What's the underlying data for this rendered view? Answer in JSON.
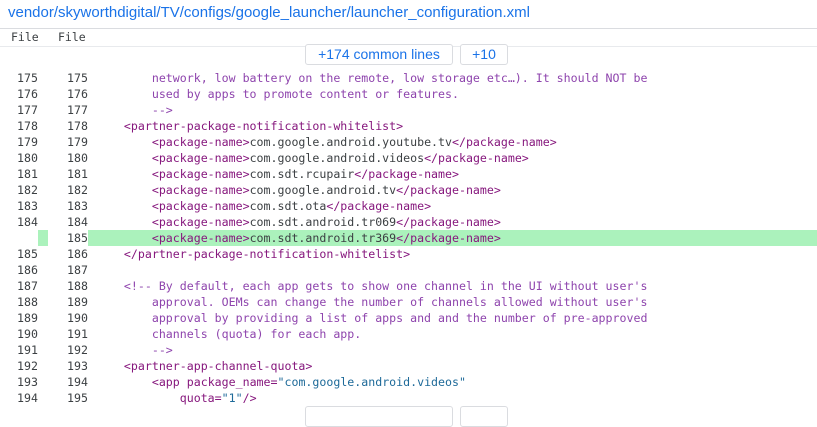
{
  "file_path": "vendor/skyworthdigital/TV/configs/google_launcher/launcher_configuration.xml",
  "columns": [
    "File",
    "File"
  ],
  "expand": {
    "common_lines": "+174 common lines",
    "more": "+10"
  },
  "lines": [
    {
      "l": "175",
      "r": "175",
      "type": "ctx",
      "segments": [
        {
          "t": "        network, low battery on the remote, low storage etc…). It should NOT be",
          "c": "c-com"
        }
      ]
    },
    {
      "l": "176",
      "r": "176",
      "type": "ctx",
      "segments": [
        {
          "t": "        used by apps to promote content or features.",
          "c": "c-com"
        }
      ]
    },
    {
      "l": "177",
      "r": "177",
      "type": "ctx",
      "segments": [
        {
          "t": "        -->",
          "c": "c-com"
        }
      ]
    },
    {
      "l": "178",
      "r": "178",
      "type": "ctx",
      "segments": [
        {
          "t": "    <partner-package-notification-whitelist>",
          "c": "c-tag"
        }
      ]
    },
    {
      "l": "179",
      "r": "179",
      "type": "ctx",
      "segments": [
        {
          "t": "        <package-name>",
          "c": "c-tag"
        },
        {
          "t": "com.google.android.youtube.tv",
          "c": ""
        },
        {
          "t": "</package-name>",
          "c": "c-tag"
        }
      ]
    },
    {
      "l": "180",
      "r": "180",
      "type": "ctx",
      "segments": [
        {
          "t": "        <package-name>",
          "c": "c-tag"
        },
        {
          "t": "com.google.android.videos",
          "c": ""
        },
        {
          "t": "</package-name>",
          "c": "c-tag"
        }
      ]
    },
    {
      "l": "181",
      "r": "181",
      "type": "ctx",
      "segments": [
        {
          "t": "        <package-name>",
          "c": "c-tag"
        },
        {
          "t": "com.sdt.rcupair",
          "c": ""
        },
        {
          "t": "</package-name>",
          "c": "c-tag"
        }
      ]
    },
    {
      "l": "182",
      "r": "182",
      "type": "ctx",
      "segments": [
        {
          "t": "        <package-name>",
          "c": "c-tag"
        },
        {
          "t": "com.google.android.tv",
          "c": ""
        },
        {
          "t": "</package-name>",
          "c": "c-tag"
        }
      ]
    },
    {
      "l": "183",
      "r": "183",
      "type": "ctx",
      "segments": [
        {
          "t": "        <package-name>",
          "c": "c-tag"
        },
        {
          "t": "com.sdt.ota",
          "c": ""
        },
        {
          "t": "</package-name>",
          "c": "c-tag"
        }
      ]
    },
    {
      "l": "184",
      "r": "184",
      "type": "ctx",
      "segments": [
        {
          "t": "        <package-name>",
          "c": "c-tag"
        },
        {
          "t": "com.sdt.android.tr069",
          "c": ""
        },
        {
          "t": "</package-name>",
          "c": "c-tag"
        }
      ]
    },
    {
      "l": "",
      "r": "185",
      "type": "added",
      "segments": [
        {
          "t": "        <package-name>",
          "c": "c-tag"
        },
        {
          "t": "com.sdt.android.tr369",
          "c": ""
        },
        {
          "t": "</package-name>",
          "c": "c-tag"
        }
      ]
    },
    {
      "l": "185",
      "r": "186",
      "type": "ctx",
      "segments": [
        {
          "t": "    </partner-package-notification-whitelist>",
          "c": "c-tag"
        }
      ]
    },
    {
      "l": "186",
      "r": "187",
      "type": "ctx",
      "segments": [
        {
          "t": "",
          "c": ""
        }
      ]
    },
    {
      "l": "187",
      "r": "188",
      "type": "ctx",
      "segments": [
        {
          "t": "    <!-- By default, each app gets to show one channel in the UI without user's",
          "c": "c-com"
        }
      ]
    },
    {
      "l": "188",
      "r": "189",
      "type": "ctx",
      "segments": [
        {
          "t": "        approval. OEMs can change the number of channels allowed without user's",
          "c": "c-com"
        }
      ]
    },
    {
      "l": "189",
      "r": "190",
      "type": "ctx",
      "segments": [
        {
          "t": "        approval by providing a list of apps and and the number of pre-approved",
          "c": "c-com"
        }
      ]
    },
    {
      "l": "190",
      "r": "191",
      "type": "ctx",
      "segments": [
        {
          "t": "        channels (quota) for each app.",
          "c": "c-com"
        }
      ]
    },
    {
      "l": "191",
      "r": "192",
      "type": "ctx",
      "segments": [
        {
          "t": "        -->",
          "c": "c-com"
        }
      ]
    },
    {
      "l": "192",
      "r": "193",
      "type": "ctx",
      "segments": [
        {
          "t": "    <partner-app-channel-quota>",
          "c": "c-tag"
        }
      ]
    },
    {
      "l": "193",
      "r": "194",
      "type": "ctx",
      "segments": [
        {
          "t": "        <app ",
          "c": "c-tag"
        },
        {
          "t": "package_name=",
          "c": "c-tag"
        },
        {
          "t": "\"com.google.android.videos\"",
          "c": "c-str"
        }
      ]
    },
    {
      "l": "194",
      "r": "195",
      "type": "ctx",
      "segments": [
        {
          "t": "            ",
          "c": ""
        },
        {
          "t": "quota=",
          "c": "c-tag"
        },
        {
          "t": "\"1\"",
          "c": "c-str"
        },
        {
          "t": "/>",
          "c": "c-tag"
        }
      ]
    }
  ],
  "colors": {
    "link": "#1a73e8",
    "added_bg": "#abf2bc",
    "tag": "#86177d",
    "string": "#1e6a99"
  }
}
